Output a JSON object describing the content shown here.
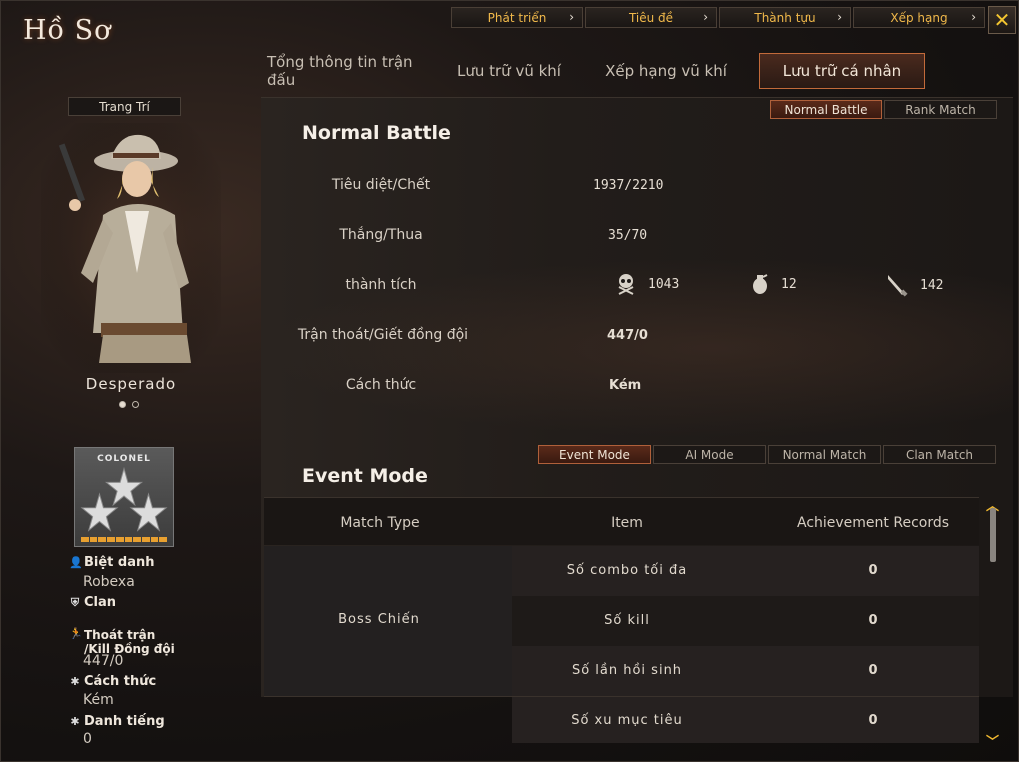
{
  "window": {
    "title": "Hồ Sơ"
  },
  "top_nav": [
    {
      "label": "Phát triển"
    },
    {
      "label": "Tiêu đề"
    },
    {
      "label": "Thành tựu"
    },
    {
      "label": "Xếp hạng"
    }
  ],
  "main_tabs": [
    {
      "label": "Tổng thông tin trận đấu",
      "active": false
    },
    {
      "label": "Lưu trữ vũ khí",
      "active": false
    },
    {
      "label": "Xếp hạng vũ khí",
      "active": false
    },
    {
      "label": "Lưu trữ cá nhân",
      "active": true
    }
  ],
  "left": {
    "decoration_label": "Trang Trí",
    "character_name": "Desperado",
    "rank_name": "COLONEL",
    "rank_progress": 1.0,
    "nickname_label": "Biệt danh",
    "nickname": "Robexa",
    "clan_label": "Clan",
    "escape_label_1": "Thoát trận",
    "escape_label_2": "/Kill Đồng đội",
    "escape_value": "447/0",
    "style_label": "Cách thức",
    "style_value": "Kém",
    "fame_label": "Danh tiếng",
    "fame_value": "0"
  },
  "battle_modes": [
    {
      "label": "Normal Battle",
      "active": true
    },
    {
      "label": "Rank Match",
      "active": false
    }
  ],
  "normal_battle": {
    "title": "Normal Battle",
    "kd_label": "Tiêu diệt/Chết",
    "kd_value": "1937/2210",
    "wl_label": "Thắng/Thua",
    "wl_value": "35/70",
    "achievement_label": "thành tích",
    "achievements": [
      {
        "icon": "skull-icon",
        "value": "1043"
      },
      {
        "icon": "grenade-icon",
        "value": "12"
      },
      {
        "icon": "knife-icon",
        "value": "142"
      }
    ],
    "escape_label": "Trận thoát/Giết đồng đội",
    "escape_value": "447/0",
    "style_label": "Cách thức",
    "style_value": "Kém"
  },
  "event_tabs": [
    {
      "label": "Event Mode",
      "active": true
    },
    {
      "label": "AI Mode",
      "active": false
    },
    {
      "label": "Normal Match",
      "active": false
    },
    {
      "label": "Clan Match",
      "active": false
    }
  ],
  "event_mode": {
    "title": "Event Mode",
    "columns": [
      "Match Type",
      "Item",
      "Achievement Records"
    ],
    "match_type": "Boss Chiến",
    "rows": [
      {
        "item": "Số combo tối đa",
        "value": "0"
      },
      {
        "item": "Số kill",
        "value": "0"
      },
      {
        "item": "Số lần hồi sinh",
        "value": "0"
      },
      {
        "item": "Số xu mục tiêu",
        "value": "0"
      }
    ]
  },
  "colors": {
    "accent": "#f0b84a",
    "active_tab_border": "#c26a3a",
    "close_x": "#f4c630"
  }
}
